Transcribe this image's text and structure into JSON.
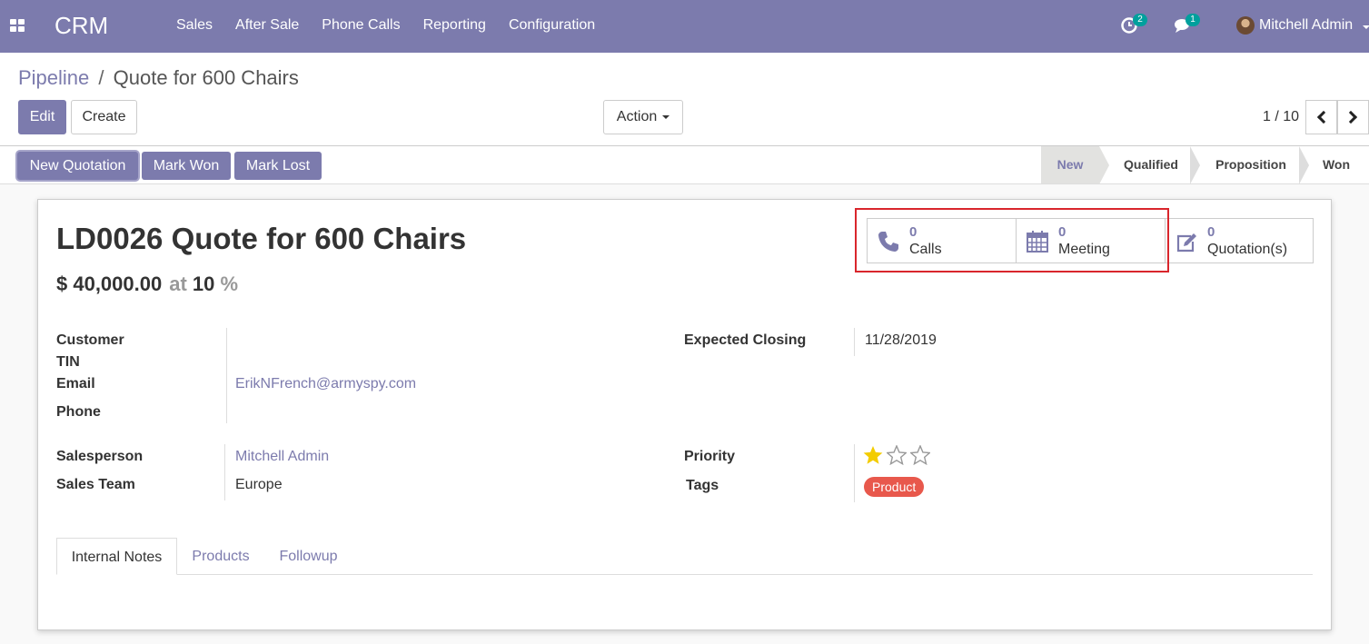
{
  "navbar": {
    "app_name": "CRM",
    "menu": [
      "Sales",
      "After Sale",
      "Phone Calls",
      "Reporting",
      "Configuration"
    ],
    "activity_count": "2",
    "messages_count": "1",
    "user": "Mitchell Admin",
    "color": "#7c7bad"
  },
  "breadcrumb": {
    "parent": "Pipeline",
    "current": "Quote for 600 Chairs"
  },
  "buttons": {
    "edit": "Edit",
    "create": "Create",
    "action": "Action"
  },
  "pager": {
    "value": "1 / 10"
  },
  "statusbar": {
    "buttons": [
      "New Quotation",
      "Mark Won",
      "Mark Lost"
    ],
    "stages": [
      "New",
      "Qualified",
      "Proposition",
      "Won"
    ],
    "active_stage": "New"
  },
  "smart_buttons": [
    {
      "count": "0",
      "label": "Calls",
      "icon": "phone-icon"
    },
    {
      "count": "0",
      "label": "Meeting",
      "icon": "calendar-icon"
    },
    {
      "count": "0",
      "label": "Quotation(s)",
      "icon": "pencil-square-icon"
    }
  ],
  "record": {
    "title": "LD0026 Quote for 600 Chairs",
    "revenue": "$ 40,000.00",
    "at": "at",
    "probability": "10",
    "percent": "%"
  },
  "fields": {
    "customer_label": "Customer",
    "tin_label": "TIN",
    "email_label": "Email",
    "email": "ErikNFrench@armyspy.com",
    "phone_label": "Phone",
    "salesperson_label": "Salesperson",
    "salesperson": "Mitchell Admin",
    "sales_team_label": "Sales Team",
    "sales_team": "Europe",
    "expected_closing_label": "Expected Closing",
    "expected_closing": "11/28/2019",
    "priority_label": "Priority",
    "priority": 1,
    "priority_max": 3,
    "tags_label": "Tags",
    "tags": [
      "Product"
    ],
    "tag_color": "#e8584c"
  },
  "tabs": [
    "Internal Notes",
    "Products",
    "Followup"
  ],
  "active_tab": "Internal Notes"
}
